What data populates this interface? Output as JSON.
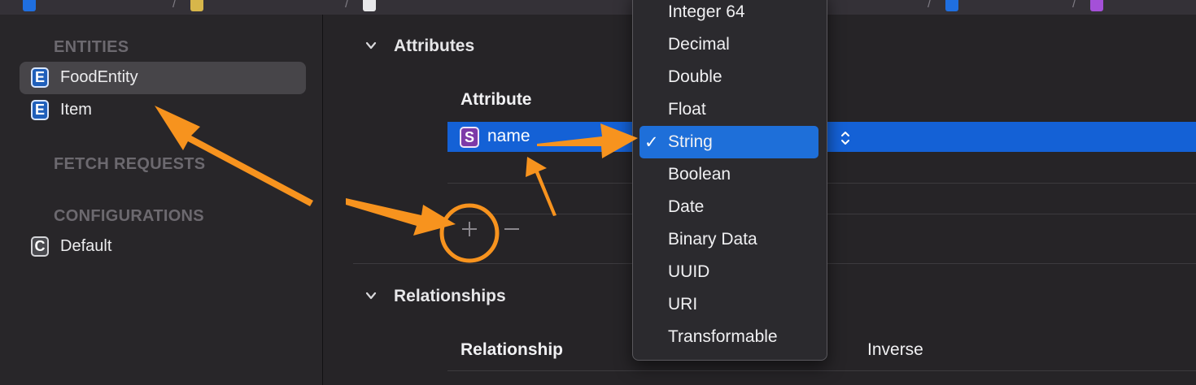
{
  "sidebar": {
    "entities_header": "ENTITIES",
    "entities": [
      {
        "badge": "E",
        "label": "FoodEntity",
        "selected": true
      },
      {
        "badge": "E",
        "label": "Item",
        "selected": false
      }
    ],
    "fetch_requests_header": "FETCH REQUESTS",
    "configurations_header": "CONFIGURATIONS",
    "configurations": [
      {
        "badge": "C",
        "label": "Default"
      }
    ]
  },
  "attributes": {
    "title": "Attributes",
    "column_attribute": "Attribute",
    "rows": [
      {
        "badge": "S",
        "name": "name",
        "type": "String",
        "selected": true
      }
    ],
    "add_icon": "plus-icon",
    "remove_icon": "minus-icon"
  },
  "relationships": {
    "title": "Relationships",
    "column_relationship": "Relationship",
    "column_inverse": "Inverse"
  },
  "type_menu": {
    "items": [
      "Integer 64",
      "Decimal",
      "Double",
      "Float",
      "String",
      "Boolean",
      "Date",
      "Binary Data",
      "UUID",
      "URI",
      "Transformable"
    ],
    "selected": "String",
    "check_glyph": "✓"
  },
  "colors": {
    "selection_blue": "#1461d6",
    "menu_highlight": "#1e6fd9",
    "annotation_orange": "#f7931e",
    "entity_badge": "#1f5fba",
    "string_badge": "#7d3aa8"
  }
}
